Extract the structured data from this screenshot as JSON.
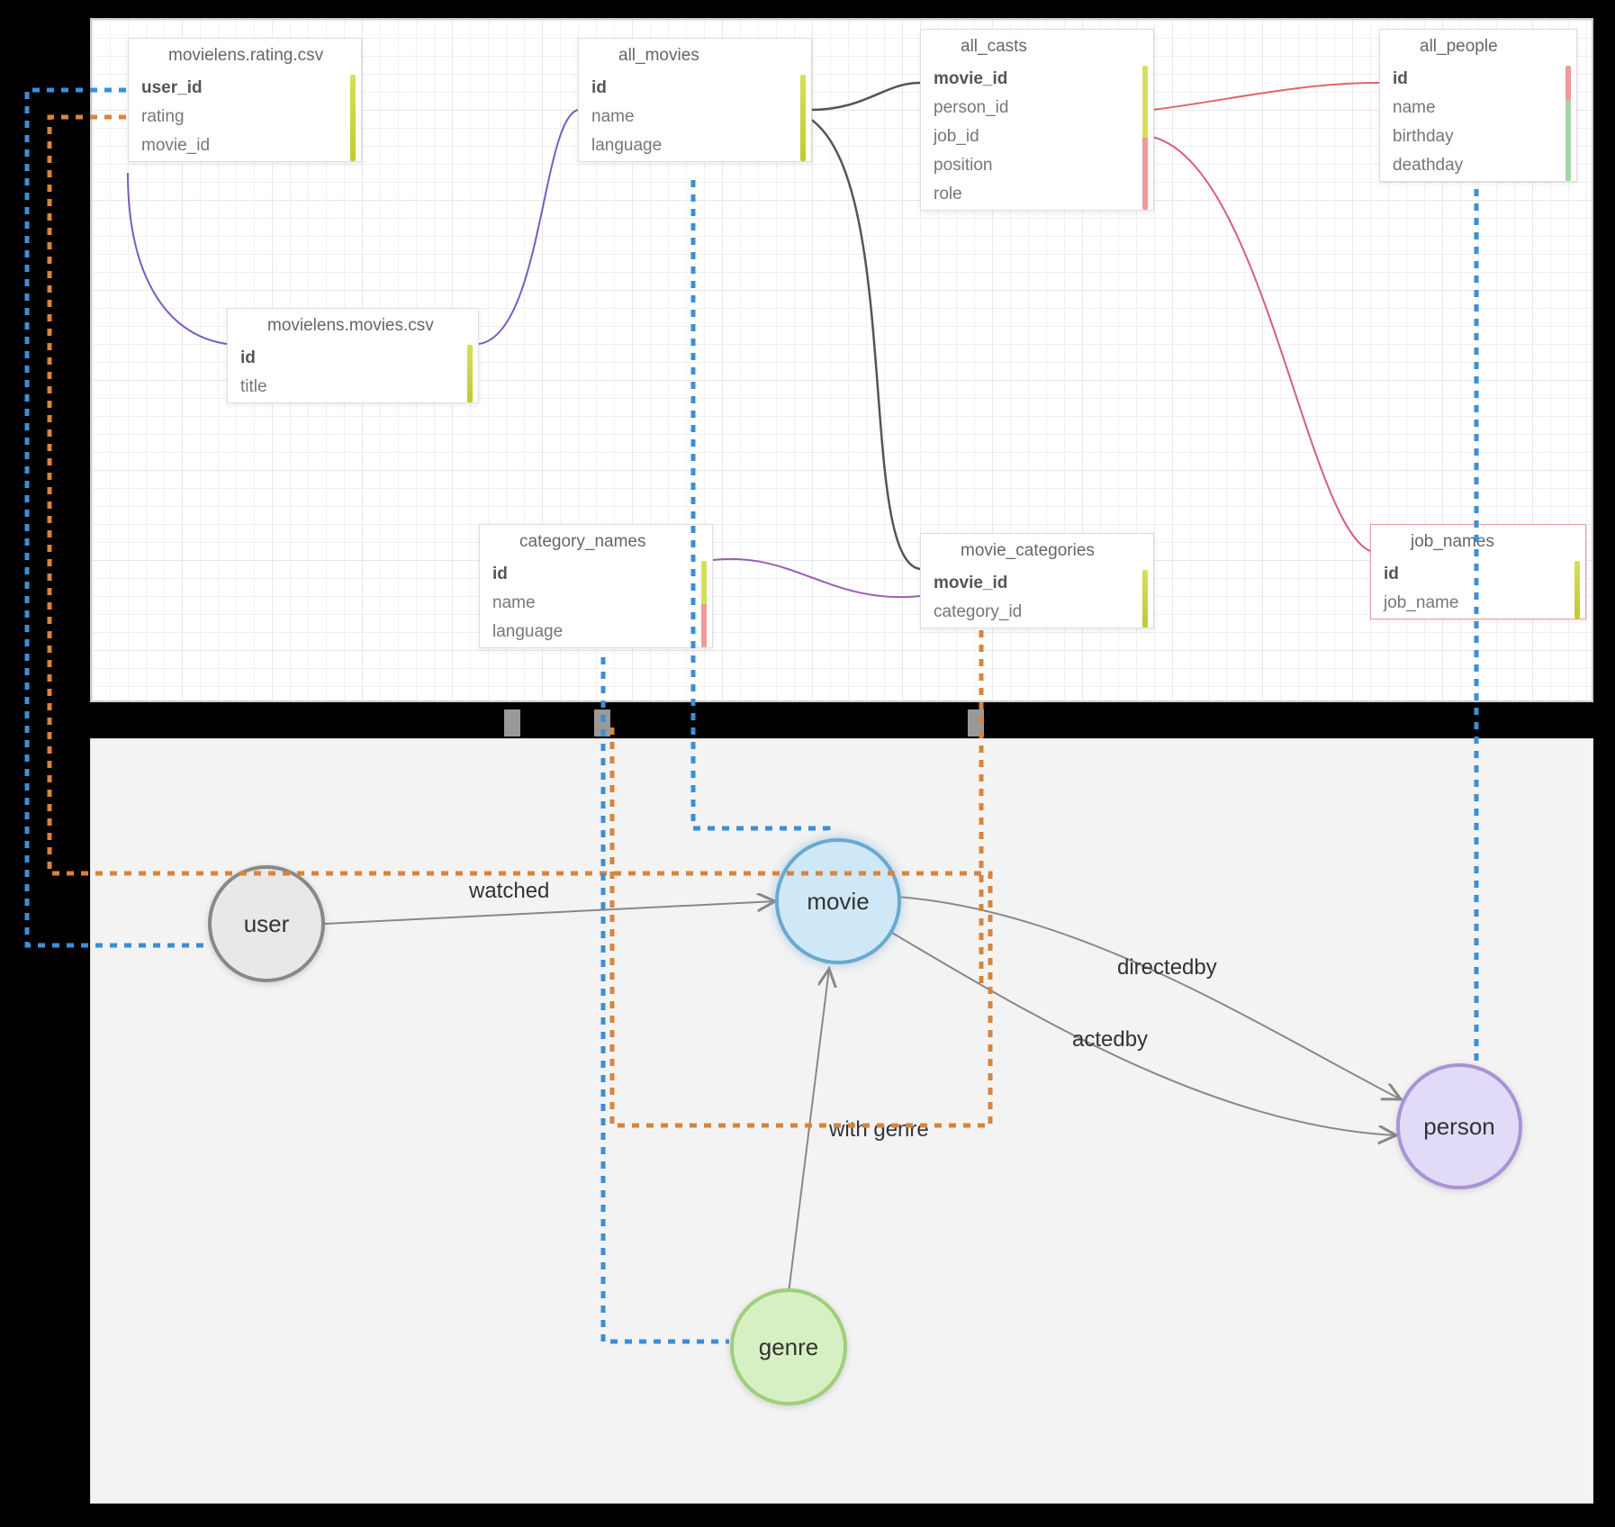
{
  "tables": {
    "rating": {
      "title": "movielens.rating.csv",
      "fields": [
        {
          "name": "user_id",
          "bold": true
        },
        {
          "name": "rating",
          "bold": false
        },
        {
          "name": "movie_id",
          "bold": false
        }
      ]
    },
    "all_movies": {
      "title": "all_movies",
      "fields": [
        {
          "name": "id",
          "bold": true
        },
        {
          "name": "name",
          "bold": false
        },
        {
          "name": "language",
          "bold": false
        }
      ]
    },
    "all_casts": {
      "title": "all_casts",
      "fields": [
        {
          "name": "movie_id",
          "bold": true
        },
        {
          "name": "person_id",
          "bold": false
        },
        {
          "name": "job_id",
          "bold": false
        },
        {
          "name": "position",
          "bold": false
        },
        {
          "name": "role",
          "bold": false
        }
      ]
    },
    "all_people": {
      "title": "all_people",
      "fields": [
        {
          "name": "id",
          "bold": true
        },
        {
          "name": "name",
          "bold": false
        },
        {
          "name": "birthday",
          "bold": false
        },
        {
          "name": "deathday",
          "bold": false
        }
      ]
    },
    "movies_csv": {
      "title": "movielens.movies.csv",
      "fields": [
        {
          "name": "id",
          "bold": true
        },
        {
          "name": "title",
          "bold": false
        }
      ]
    },
    "category_names": {
      "title": "category_names",
      "fields": [
        {
          "name": "id",
          "bold": true
        },
        {
          "name": "name",
          "bold": false
        },
        {
          "name": "language",
          "bold": false
        }
      ]
    },
    "movie_categories": {
      "title": "movie_categories",
      "fields": [
        {
          "name": "movie_id",
          "bold": true
        },
        {
          "name": "category_id",
          "bold": false
        }
      ]
    },
    "job_names": {
      "title": "job_names",
      "fields": [
        {
          "name": "id",
          "bold": true
        },
        {
          "name": "job_name",
          "bold": false
        }
      ]
    }
  },
  "nodes": {
    "user": "user",
    "movie": "movie",
    "genre": "genre",
    "person": "person"
  },
  "edges": {
    "watched": "watched",
    "directedby": "directedby",
    "actedby": "actedby",
    "with_genre": "with genre"
  }
}
